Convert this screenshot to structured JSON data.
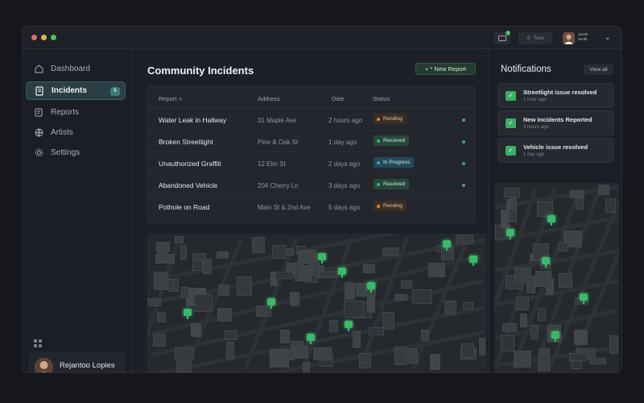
{
  "titlebar": {
    "user_name": "Jacob",
    "user_sub": "Smith",
    "search_label": "Tove",
    "notif_count": "1"
  },
  "sidebar": {
    "items": [
      {
        "label": "Dashboard",
        "icon": "home-icon"
      },
      {
        "label": "Incidents",
        "icon": "incident-icon",
        "badge": "5"
      },
      {
        "label": "Reports",
        "icon": "report-icon"
      },
      {
        "label": "Artists",
        "icon": "globe-icon"
      },
      {
        "label": "Settings",
        "icon": "settings-icon"
      }
    ],
    "user": {
      "name": "Rejantoo Lopies",
      "status": "online"
    }
  },
  "main": {
    "title": "Community Incidents",
    "new_button": "+ * New Report",
    "columns": [
      "Report",
      "Address",
      "Date",
      "Status"
    ],
    "rows": [
      {
        "report": "Water Leak in Hallway",
        "address": "31 Maple Ave",
        "date": "2 hours ago",
        "status": "Pending"
      },
      {
        "report": "Broken Streetlight",
        "address": "Pine & Oak St",
        "date": "1 day ago",
        "status": "Resolved"
      },
      {
        "report": "Unauthorized Graffiti",
        "address": "12 Elm St",
        "date": "2 days ago",
        "status": "In Progress"
      },
      {
        "report": "Abandoned Vehicle",
        "address": "204 Cherry Ln",
        "date": "3 days ago",
        "status": "Resolved"
      },
      {
        "report": "Pothole on Road",
        "address": "Main St & 2nd Ave",
        "date": "5 days ago",
        "status": "Pending"
      }
    ]
  },
  "notifications": {
    "title": "Notifications",
    "view_all": "View all",
    "items": [
      {
        "text": "Streetlight issue resolved",
        "time": "1 hour ago"
      },
      {
        "text": "New Incidents Reported",
        "time": "3 hours ago"
      },
      {
        "text": "Vehicle issue resolved",
        "time": "1 day ago"
      }
    ]
  },
  "colors": {
    "accent": "#3bb86a",
    "pending": "#d9892e",
    "resolved": "#3bb86a",
    "in_progress": "#3aa3c4"
  }
}
